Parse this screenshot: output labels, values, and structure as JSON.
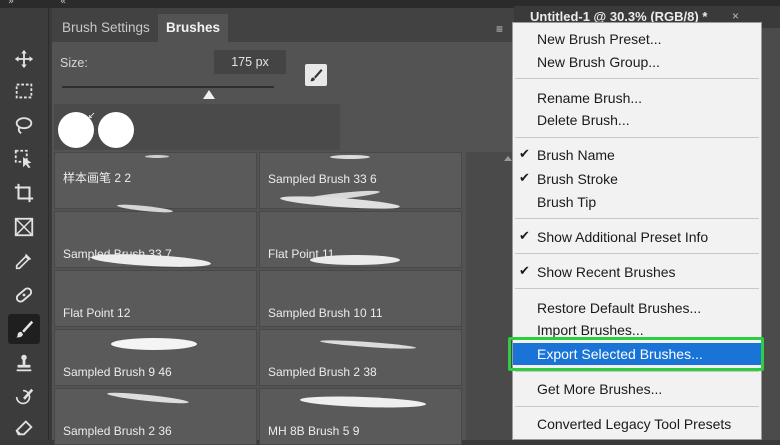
{
  "topbar": {
    "collapse_left": "»",
    "collapse_panel": "«"
  },
  "panel": {
    "tabs": [
      "Brush Settings",
      "Brushes"
    ],
    "size_label": "Size:",
    "size_value": "175 px",
    "brushes": [
      "样本画笔 2 2",
      "Sampled Brush 33 6",
      "Sampled Brush 33 7",
      "Flat Point 11",
      "Flat Point 12",
      "Sampled Brush 10 11",
      "Sampled Brush 9 46",
      "Sampled Brush 2 38",
      "Sampled Brush 2 36",
      "MH 8B Brush 5 9"
    ]
  },
  "document": {
    "title": "Untitled-1 @ 30.3% (RGB/8) *",
    "close": "×"
  },
  "menu": {
    "items": [
      "New Brush Preset...",
      "New Brush Group...",
      "Rename Brush...",
      "Delete Brush...",
      "Brush Name",
      "Brush Stroke",
      "Brush Tip",
      "Show Additional Preset Info",
      "Show Recent Brushes",
      "Restore Default Brushes...",
      "Import Brushes...",
      "Export Selected Brushes...",
      "Get More Brushes...",
      "Converted Legacy Tool Presets"
    ],
    "check": "✔",
    "highlight_color": "#1a73d6",
    "annotation_color": "#2ecc40"
  }
}
